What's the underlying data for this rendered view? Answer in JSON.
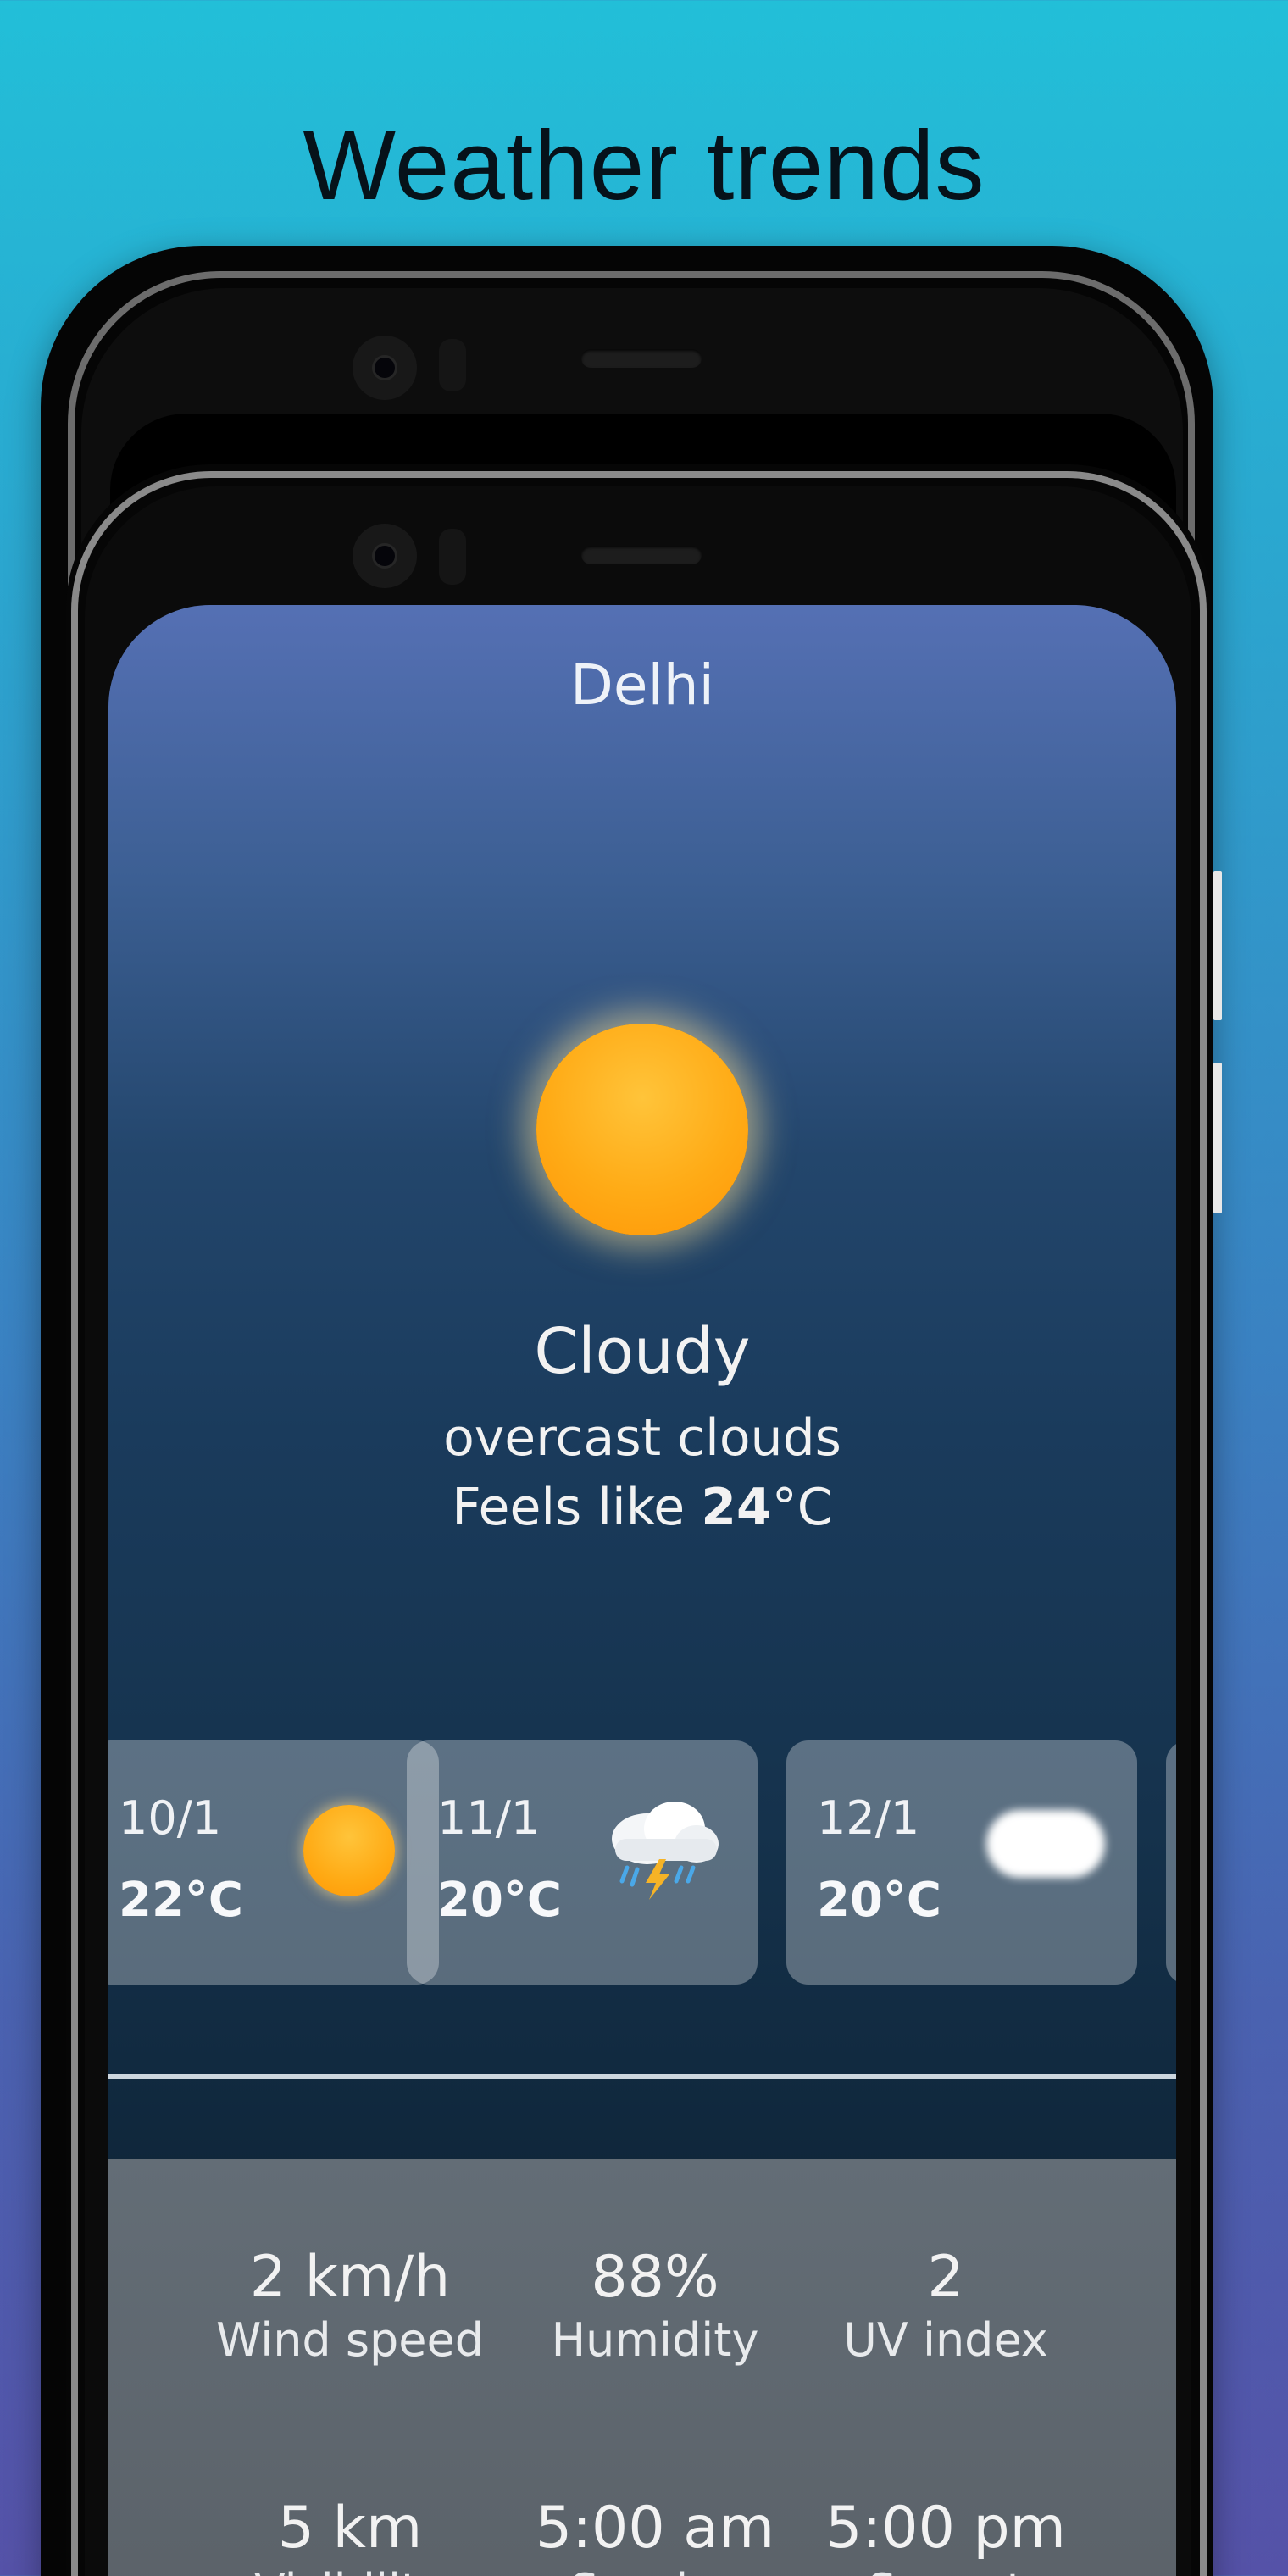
{
  "promo": {
    "title": "Weather trends"
  },
  "weather": {
    "city": "Delhi",
    "condition": "Cloudy",
    "description": "overcast clouds",
    "feels_like_prefix": "Feels like ",
    "feels_like_value": "24",
    "feels_like_unit": "°C",
    "main_icon": "sun-icon"
  },
  "forecast": [
    {
      "date": "10/1",
      "temp": "22°C",
      "icon": "sun-icon"
    },
    {
      "date": "11/1",
      "temp": "20°C",
      "icon": "thunderstorm-icon"
    },
    {
      "date": "12/1",
      "temp": "20°C",
      "icon": "cloud-icon"
    }
  ],
  "details": {
    "wind_speed": {
      "value": "2 km/h",
      "label": "Wind speed"
    },
    "humidity": {
      "value": "88%",
      "label": "Humidity"
    },
    "uv_index": {
      "value": "2",
      "label": "UV index"
    },
    "visibility": {
      "value": "5 km",
      "label": "Visibility"
    },
    "sunrise": {
      "value": "5:00 am",
      "label": "Sunrise"
    },
    "sunset": {
      "value": "5:00 pm",
      "label": "Sunset"
    }
  },
  "colors": {
    "background_top": "#22bfd8",
    "background_bottom": "#5552a8",
    "sun": "#ffaa14"
  }
}
